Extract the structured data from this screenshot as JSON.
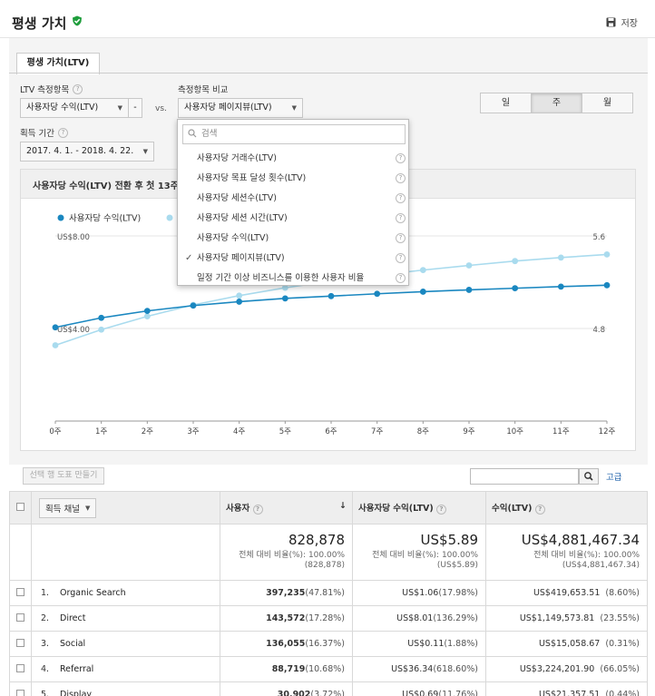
{
  "header": {
    "title": "평생 가치",
    "save_label": "저장"
  },
  "tab": {
    "label": "평생 가치(LTV)"
  },
  "controls": {
    "metric_label": "LTV 측정항목",
    "metric_value": "사용자당 수익(LTV)",
    "metric_minus": "-",
    "vs": "vs.",
    "compare_label": "측정항목 비교",
    "compare_value": "사용자당 페이지뷰(LTV)",
    "period_label": "획득 기간",
    "period_value": "2017. 4. 1. - 2018. 4. 22.",
    "granularity": [
      "일",
      "주",
      "월"
    ],
    "granularity_selected": "주"
  },
  "dropdown": {
    "placeholder": "검색",
    "items": [
      {
        "label": "사용자당 거래수(LTV)",
        "checked": false
      },
      {
        "label": "사용자당 목표 달성 횟수(LTV)",
        "checked": false
      },
      {
        "label": "사용자당 세션수(LTV)",
        "checked": false
      },
      {
        "label": "사용자당 세션 시간(LTV)",
        "checked": false
      },
      {
        "label": "사용자당 수익(LTV)",
        "checked": false
      },
      {
        "label": "사용자당 페이지뷰(LTV)",
        "checked": true
      },
      {
        "label": "일정 기간 이상 비즈니스를 이용한 사용자 비율",
        "checked": false
      }
    ]
  },
  "chart_title": "사용자당 수익(LTV) 전환 후 첫 13주",
  "chart_data": {
    "type": "line",
    "categories": [
      "0주",
      "1주",
      "2주",
      "3주",
      "4주",
      "5주",
      "6주",
      "7주",
      "8주",
      "9주",
      "10주",
      "11주",
      "12주"
    ],
    "left_axis_ticks": [
      "US$8.00",
      "US$4.00"
    ],
    "right_axis_ticks": [
      "5.6",
      "4.8"
    ],
    "series": [
      {
        "name": "사용자당 수익(LTV)",
        "axis": "left",
        "color": "#1a87c0",
        "values": [
          4.05,
          4.46,
          4.76,
          4.99,
          5.16,
          5.3,
          5.4,
          5.5,
          5.59,
          5.67,
          5.74,
          5.81,
          5.87
        ]
      },
      {
        "name": "사용자당 페이지뷰(LTV)",
        "axis": "right",
        "color": "#a9dbee",
        "values": [
          4.655,
          4.79,
          4.905,
          5.004,
          5.084,
          5.152,
          5.21,
          5.26,
          5.305,
          5.345,
          5.383,
          5.413,
          5.44
        ]
      }
    ],
    "left_ylim": [
      0,
      8
    ],
    "right_ylim": [
      4,
      5.6
    ]
  },
  "toolbar": {
    "create_chart": "선택 행 도표 만들기",
    "advanced": "고급"
  },
  "table": {
    "headers": {
      "channel": "획득 채널",
      "users": "사용자",
      "rev_per_user": "사용자당 수익(LTV)",
      "revenue": "수익(LTV)"
    },
    "summary": {
      "users": "828,878",
      "users_sub": "전체 대비 비율(%): 100.00%",
      "users_sub2": "(828,878)",
      "rpu": "US$5.89",
      "rpu_sub": "전체 대비 비율(%): 100.00%",
      "rpu_sub2": "(US$5.89)",
      "rev": "US$4,881,467.34",
      "rev_sub": "전체 대비 비율(%): 100.00%",
      "rev_sub2": "(US$4,881,467.34)"
    },
    "rows": [
      {
        "idx": "1.",
        "channel": "Organic Search",
        "users": "397,235",
        "users_pct": "(47.81%)",
        "rpu": "US$1.06",
        "rpu_pct": "(17.98%)",
        "rev": "US$419,653.51",
        "rev_pct": "(8.60%)"
      },
      {
        "idx": "2.",
        "channel": "Direct",
        "users": "143,572",
        "users_pct": "(17.28%)",
        "rpu": "US$8.01",
        "rpu_pct": "(136.29%)",
        "rev": "US$1,149,573.81",
        "rev_pct": "(23.55%)"
      },
      {
        "idx": "3.",
        "channel": "Social",
        "users": "136,055",
        "users_pct": "(16.37%)",
        "rpu": "US$0.11",
        "rpu_pct": "(1.88%)",
        "rev": "US$15,058.67",
        "rev_pct": "(0.31%)"
      },
      {
        "idx": "4.",
        "channel": "Referral",
        "users": "88,719",
        "users_pct": "(10.68%)",
        "rpu": "US$36.34",
        "rpu_pct": "(618.60%)",
        "rev": "US$3,224,201.90",
        "rev_pct": "(66.05%)"
      },
      {
        "idx": "5.",
        "channel": "Display",
        "users": "30,902",
        "users_pct": "(3.72%)",
        "rpu": "US$0.69",
        "rpu_pct": "(11.76%)",
        "rev": "US$21,357.51",
        "rev_pct": "(0.44%)"
      }
    ]
  }
}
